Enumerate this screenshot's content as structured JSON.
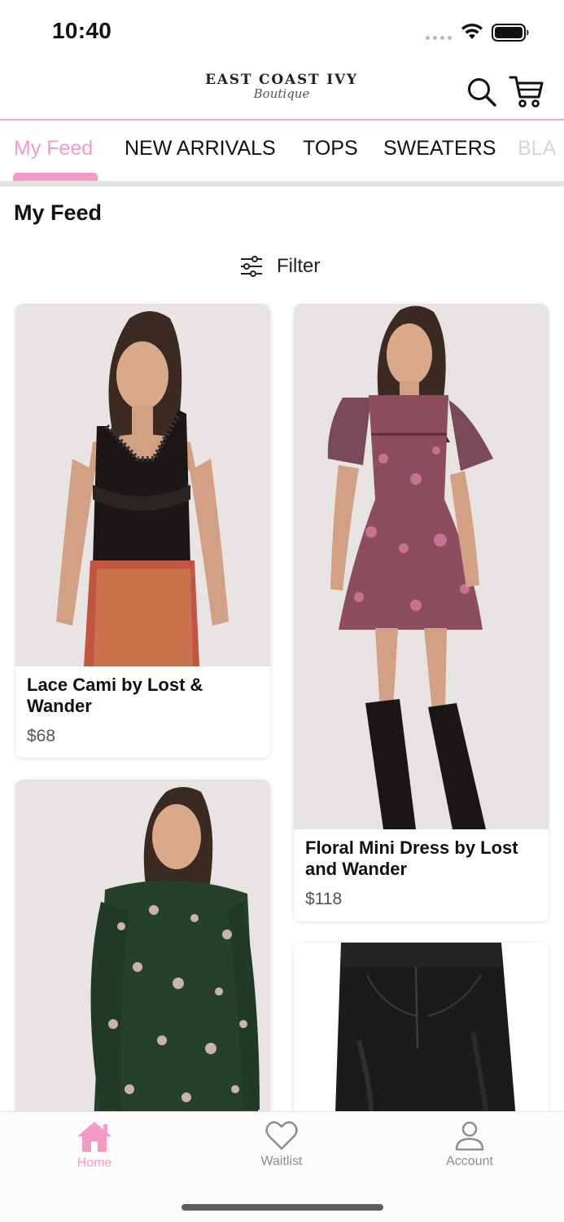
{
  "status_bar": {
    "time": "10:40",
    "icons": [
      "signal-dots",
      "wifi-icon",
      "battery-icon"
    ]
  },
  "header": {
    "logo_main": "EAST COAST IVY",
    "logo_script": "Boutique",
    "icons": [
      "search-icon",
      "cart-icon"
    ]
  },
  "tabs": [
    {
      "label": "My Feed",
      "active": true
    },
    {
      "label": "NEW ARRIVALS",
      "active": false
    },
    {
      "label": "TOPS",
      "active": false
    },
    {
      "label": "SWEATERS",
      "active": false
    },
    {
      "label": "BLA",
      "active": false
    }
  ],
  "page": {
    "title": "My Feed",
    "filter_label": "Filter"
  },
  "products": [
    {
      "name": "Lace Cami by Lost & Wander",
      "price": "$68"
    },
    {
      "name": "Floral Mini Dress by Lost and Wander",
      "price": "$118"
    },
    {
      "name": "",
      "price": ""
    },
    {
      "name": "",
      "price": ""
    }
  ],
  "bottom_nav": [
    {
      "label": "Home",
      "icon": "home-icon",
      "active": true
    },
    {
      "label": "Waitlist",
      "icon": "heart-icon",
      "active": false
    },
    {
      "label": "Account",
      "icon": "person-icon",
      "active": false
    }
  ],
  "colors": {
    "accent_pink": "#f49ac7",
    "header_rule": "#f2a6cc",
    "image_background": "#e8e4e4"
  }
}
